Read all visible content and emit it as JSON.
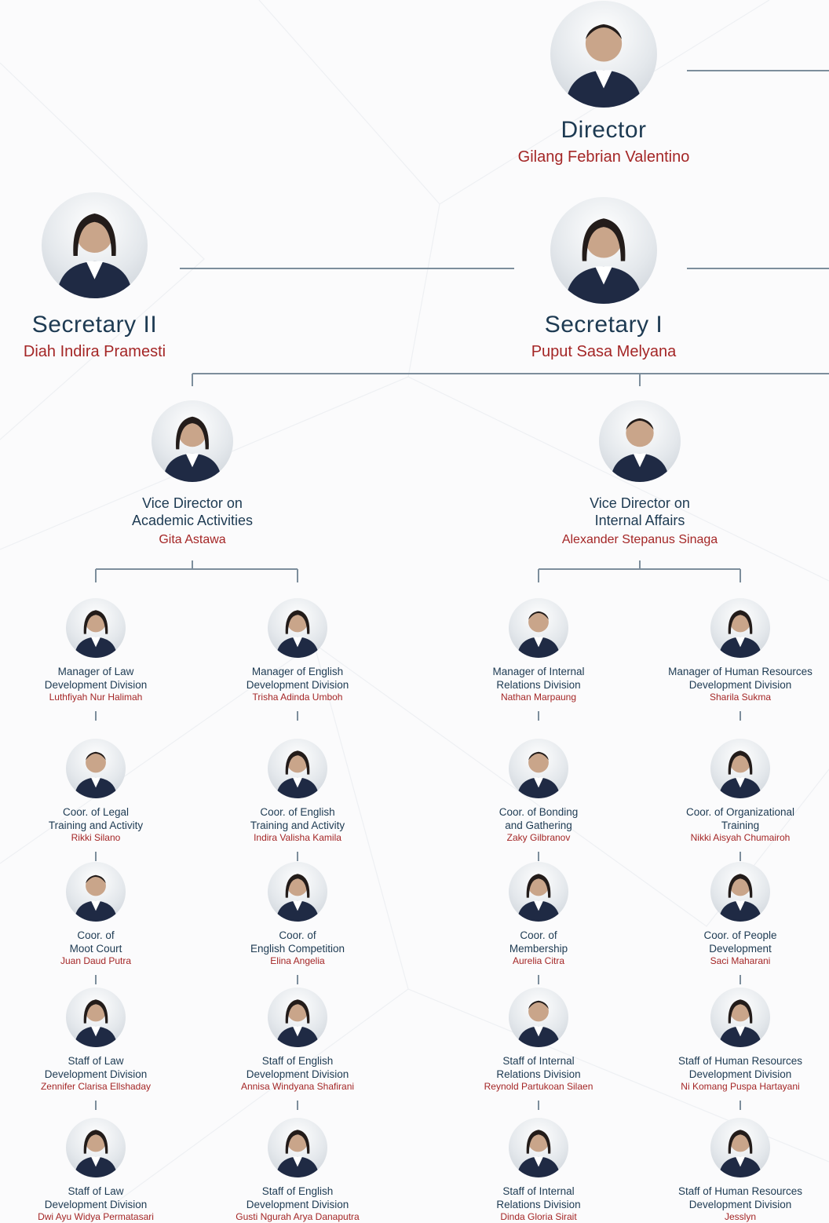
{
  "director": {
    "title": "Director",
    "name": "Gilang Febrian Valentino"
  },
  "secretary_2": {
    "title": "Secretary II",
    "name": "Diah Indira Pramesti"
  },
  "secretary_1": {
    "title": "Secretary I",
    "name": "Puput Sasa Melyana"
  },
  "vice_academic": {
    "title_line1": "Vice Director on",
    "title_line2": "Academic Activities",
    "name": "Gita Astawa"
  },
  "vice_internal": {
    "title_line1": "Vice Director on",
    "title_line2": "Internal Affairs",
    "name": "Alexander Stepanus Sinaga"
  },
  "columns": [
    {
      "members": [
        {
          "title": [
            "Manager of Law",
            "Development Division"
          ],
          "name": "Luthfiyah Nur Halimah"
        },
        {
          "title": [
            "Coor. of Legal",
            "Training and Activity"
          ],
          "name": "Rikki Silano"
        },
        {
          "title": [
            "Coor. of",
            "Moot Court"
          ],
          "name": "Juan Daud Putra"
        },
        {
          "title": [
            "Staff of Law",
            "Development Division"
          ],
          "name": "Zennifer Clarisa Ellshaday"
        },
        {
          "title": [
            "Staff of Law",
            "Development Division"
          ],
          "name": "Dwi Ayu Widya Permatasari"
        }
      ]
    },
    {
      "members": [
        {
          "title": [
            "Manager of English",
            "Development Division"
          ],
          "name": "Trisha Adinda Umboh"
        },
        {
          "title": [
            "Coor. of English",
            "Training and Activity"
          ],
          "name": "Indira Valisha Kamila"
        },
        {
          "title": [
            "Coor. of",
            "English Competition"
          ],
          "name": "Elina Angelia"
        },
        {
          "title": [
            "Staff of English",
            "Development Division"
          ],
          "name": "Annisa Windyana Shafirani"
        },
        {
          "title": [
            "Staff of English",
            "Development Division"
          ],
          "name": "Gusti Ngurah Arya Danaputra"
        }
      ]
    },
    {
      "members": [
        {
          "title": [
            "Manager of Internal",
            "Relations Division"
          ],
          "name": "Nathan Marpaung"
        },
        {
          "title": [
            "Coor. of Bonding",
            "and Gathering"
          ],
          "name": "Zaky Gilbranov"
        },
        {
          "title": [
            "Coor. of",
            "Membership"
          ],
          "name": "Aurelia Citra"
        },
        {
          "title": [
            "Staff of Internal",
            "Relations Division"
          ],
          "name": "Reynold Partukoan Silaen"
        },
        {
          "title": [
            "Staff of Internal",
            "Relations Division"
          ],
          "name": "Dinda Gloria Sirait"
        }
      ]
    },
    {
      "members": [
        {
          "title": [
            "Manager of Human Resources",
            "Development Division"
          ],
          "name": "Sharila Sukma"
        },
        {
          "title": [
            "Coor. of Organizational",
            "Training"
          ],
          "name": "Nikki Aisyah Chumairoh"
        },
        {
          "title": [
            "Coor. of People",
            "Development"
          ],
          "name": "Saci Maharani"
        },
        {
          "title": [
            "Staff of Human Resources",
            "Development Division"
          ],
          "name": "Ni Komang Puspa Hartayani"
        },
        {
          "title": [
            "Staff of Human Resources",
            "Development Division"
          ],
          "name": "Jesslyn"
        }
      ]
    }
  ],
  "colors": {
    "title": "#1d3a52",
    "name": "#a42626",
    "line": "#7d8e9c",
    "suit": "#1f2a44",
    "background": "#fbfbfc"
  }
}
